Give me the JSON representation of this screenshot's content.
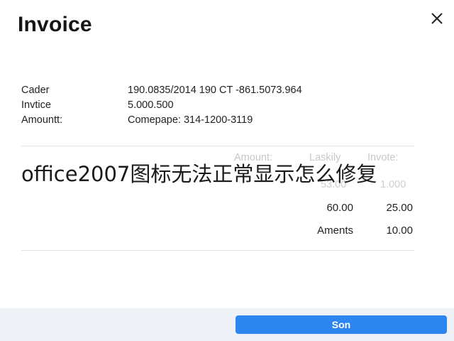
{
  "dialog": {
    "title": "Invoice",
    "close_icon": "close-icon"
  },
  "details": [
    {
      "label": "Cader",
      "value": "190.0835/2014 190 CT -861.5073.964"
    },
    {
      "label": "Invtice",
      "value": "5.000.500"
    },
    {
      "label": "Amountt:",
      "value": "Comepape: 314-1200-3119"
    }
  ],
  "summary": {
    "headers": [
      "Amount:",
      "Laskily",
      "Invote:"
    ],
    "ghost_row": [
      "53.00",
      "1.000"
    ],
    "rows": [
      {
        "label": "",
        "col1": "60.00",
        "col2": "25.00"
      },
      {
        "label": "Aments",
        "col1": "",
        "col2": "10.00"
      }
    ]
  },
  "overlay_text": "office2007图标无法正常显示怎么修复",
  "footer": {
    "button_label": "Son"
  }
}
